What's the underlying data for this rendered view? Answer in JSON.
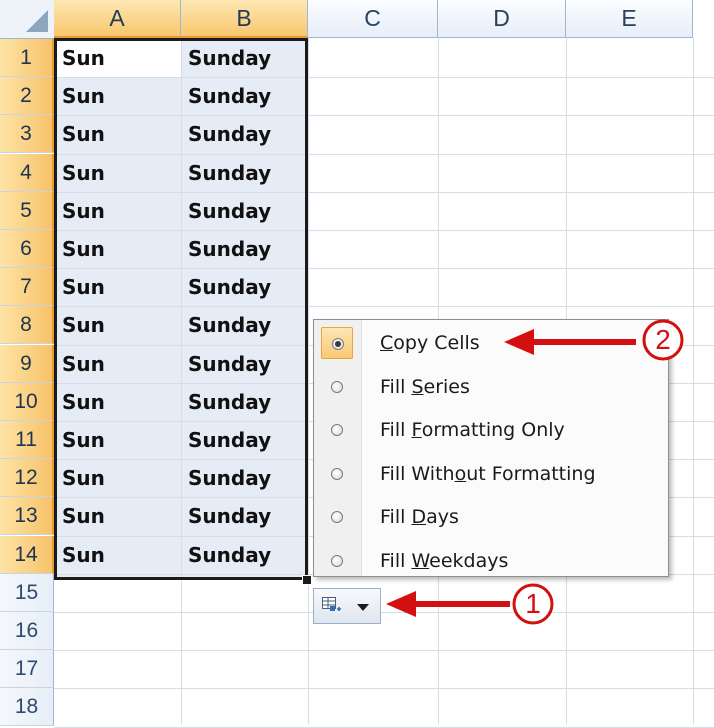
{
  "columns": [
    "A",
    "B",
    "C",
    "D",
    "E"
  ],
  "selected_columns": [
    "A",
    "B"
  ],
  "rows": [
    "1",
    "2",
    "3",
    "4",
    "5",
    "6",
    "7",
    "8",
    "9",
    "10",
    "11",
    "12",
    "13",
    "14",
    "15",
    "16",
    "17",
    "18"
  ],
  "selected_rows_count": 14,
  "cells": [
    {
      "a": "Sun",
      "b": "Sunday"
    },
    {
      "a": "Sun",
      "b": "Sunday"
    },
    {
      "a": "Sun",
      "b": "Sunday"
    },
    {
      "a": "Sun",
      "b": "Sunday"
    },
    {
      "a": "Sun",
      "b": "Sunday"
    },
    {
      "a": "Sun",
      "b": "Sunday"
    },
    {
      "a": "Sun",
      "b": "Sunday"
    },
    {
      "a": "Sun",
      "b": "Sunday"
    },
    {
      "a": "Sun",
      "b": "Sunday"
    },
    {
      "a": "Sun",
      "b": "Sunday"
    },
    {
      "a": "Sun",
      "b": "Sunday"
    },
    {
      "a": "Sun",
      "b": "Sunday"
    },
    {
      "a": "Sun",
      "b": "Sunday"
    },
    {
      "a": "Sun",
      "b": "Sunday"
    }
  ],
  "autofill_menu": {
    "items": [
      {
        "before": "",
        "key": "C",
        "after": "opy Cells",
        "checked": true
      },
      {
        "before": "Fill ",
        "key": "S",
        "after": "eries",
        "checked": false
      },
      {
        "before": "Fill ",
        "key": "F",
        "after": "ormatting Only",
        "checked": false
      },
      {
        "before": "Fill With",
        "key": "o",
        "after": "ut Formatting",
        "checked": false
      },
      {
        "before": "Fill ",
        "key": "D",
        "after": "ays",
        "checked": false
      },
      {
        "before": "Fill ",
        "key": "W",
        "after": "eekdays",
        "checked": false
      }
    ]
  },
  "autofill_button": {
    "icon": "auto-fill-options-icon",
    "arrow": "dropdown-arrow-icon"
  },
  "annotations": [
    {
      "number": "1",
      "color": "#d40f0f"
    },
    {
      "number": "2",
      "color": "#d40f0f"
    }
  ],
  "colors": {
    "selection_header": "#f8c66d",
    "selection_fill": "#e6ecf6",
    "header_text": "#27415f",
    "annotation_red": "#d40f0f"
  }
}
